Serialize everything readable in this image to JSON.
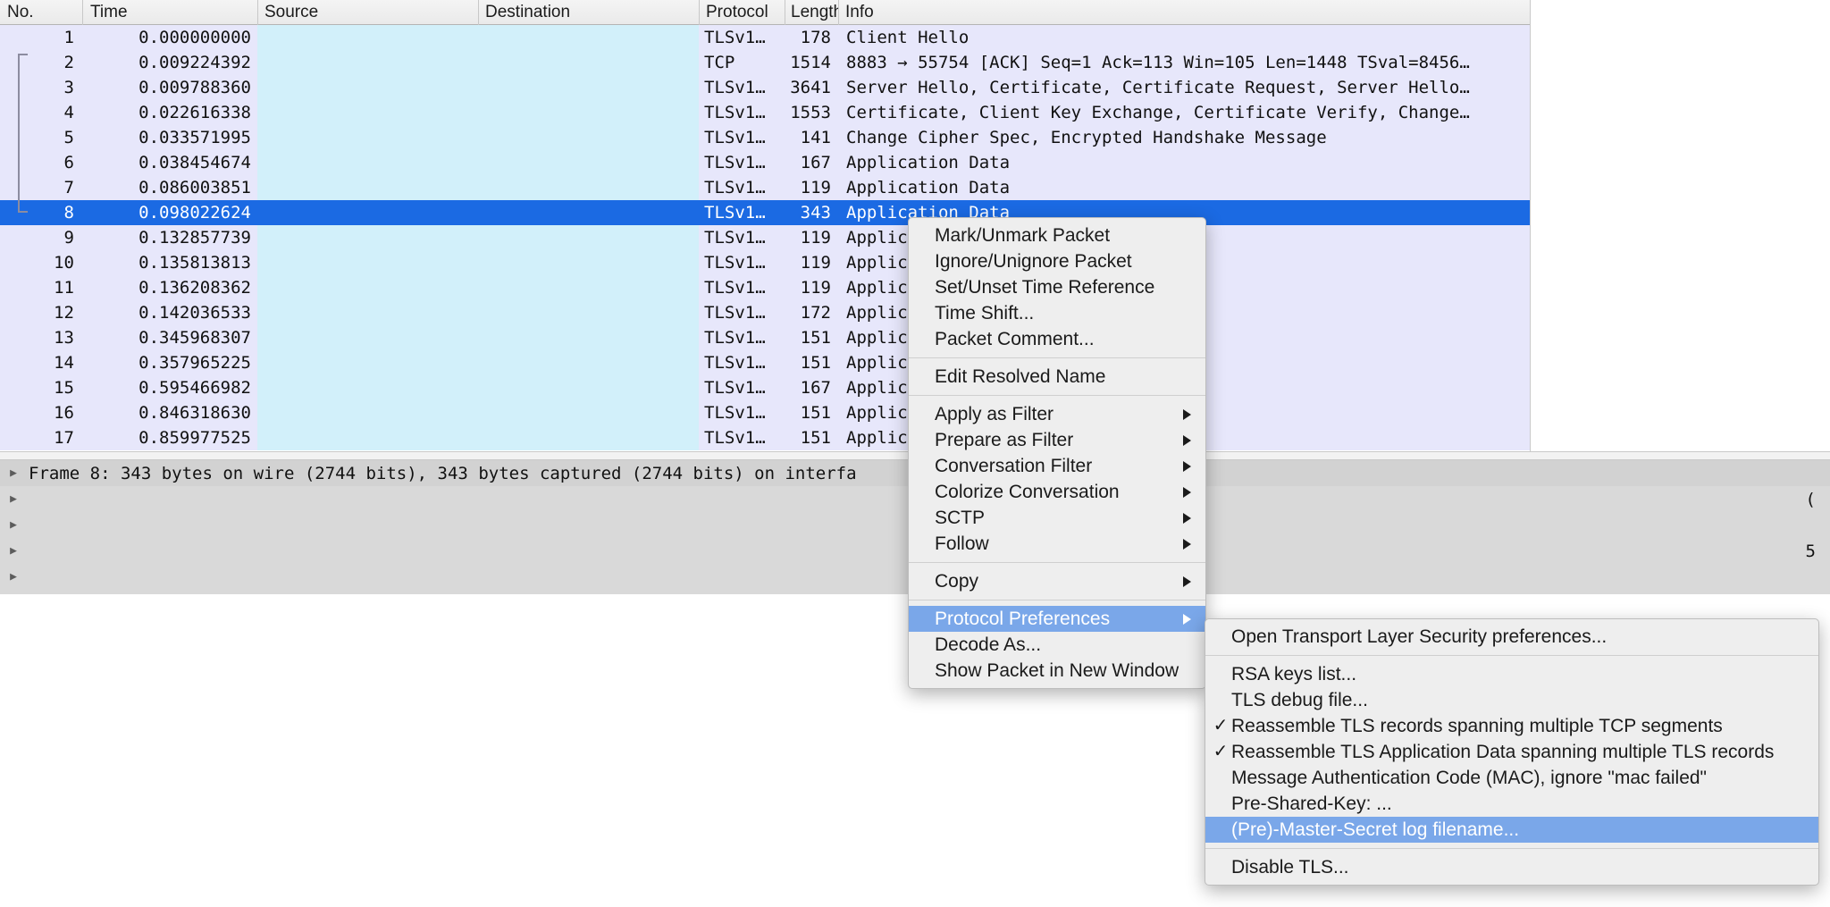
{
  "packet_list": {
    "columns": [
      "No.",
      "Time",
      "Source",
      "Destination",
      "Protocol",
      "Length",
      "Info"
    ],
    "selected_no": 8,
    "rows": [
      {
        "no": "1",
        "time": "0.000000000",
        "src": "",
        "dst": "",
        "proto": "TLSv1…",
        "len": "178",
        "info": "Client Hello"
      },
      {
        "no": "2",
        "time": "0.009224392",
        "src": "",
        "dst": "",
        "proto": "TCP",
        "len": "1514",
        "info": "8883 → 55754 [ACK] Seq=1 Ack=113 Win=105 Len=1448 TSval=8456…"
      },
      {
        "no": "3",
        "time": "0.009788360",
        "src": "",
        "dst": "",
        "proto": "TLSv1…",
        "len": "3641",
        "info": "Server Hello, Certificate, Certificate Request, Server Hello…"
      },
      {
        "no": "4",
        "time": "0.022616338",
        "src": "",
        "dst": "",
        "proto": "TLSv1…",
        "len": "1553",
        "info": "Certificate, Client Key Exchange, Certificate Verify, Change…"
      },
      {
        "no": "5",
        "time": "0.033571995",
        "src": "",
        "dst": "",
        "proto": "TLSv1…",
        "len": "141",
        "info": "Change Cipher Spec, Encrypted Handshake Message"
      },
      {
        "no": "6",
        "time": "0.038454674",
        "src": "",
        "dst": "",
        "proto": "TLSv1…",
        "len": "167",
        "info": "Application Data"
      },
      {
        "no": "7",
        "time": "0.086003851",
        "src": "",
        "dst": "",
        "proto": "TLSv1…",
        "len": "119",
        "info": "Application Data"
      },
      {
        "no": "8",
        "time": "0.098022624",
        "src": "",
        "dst": "",
        "proto": "TLSv1…",
        "len": "343",
        "info": "Application Data"
      },
      {
        "no": "9",
        "time": "0.132857739",
        "src": "",
        "dst": "",
        "proto": "TLSv1…",
        "len": "119",
        "info": "Application Data"
      },
      {
        "no": "10",
        "time": "0.135813813",
        "src": "",
        "dst": "",
        "proto": "TLSv1…",
        "len": "119",
        "info": "Application Data"
      },
      {
        "no": "11",
        "time": "0.136208362",
        "src": "",
        "dst": "",
        "proto": "TLSv1…",
        "len": "119",
        "info": "Application Data"
      },
      {
        "no": "12",
        "time": "0.142036533",
        "src": "",
        "dst": "",
        "proto": "TLSv1…",
        "len": "172",
        "info": "Application Data"
      },
      {
        "no": "13",
        "time": "0.345968307",
        "src": "",
        "dst": "",
        "proto": "TLSv1…",
        "len": "151",
        "info": "Application Data"
      },
      {
        "no": "14",
        "time": "0.357965225",
        "src": "",
        "dst": "",
        "proto": "TLSv1…",
        "len": "151",
        "info": "Application Data"
      },
      {
        "no": "15",
        "time": "0.595466982",
        "src": "",
        "dst": "",
        "proto": "TLSv1…",
        "len": "167",
        "info": "Application Data"
      },
      {
        "no": "16",
        "time": "0.846318630",
        "src": "",
        "dst": "",
        "proto": "TLSv1…",
        "len": "151",
        "info": "Application Data"
      },
      {
        "no": "17",
        "time": "0.859977525",
        "src": "",
        "dst": "",
        "proto": "TLSv1…",
        "len": "151",
        "info": "Application Data"
      }
    ]
  },
  "detail_pane": {
    "rows": [
      {
        "text": "Frame 8: 343 bytes on wire (2744 bits), 343 bytes captured (2744 bits) on interfa",
        "tail": ""
      },
      {
        "text": "",
        "tail": "("
      },
      {
        "text": "",
        "tail": ""
      },
      {
        "text": "",
        "tail": "5"
      },
      {
        "text": "",
        "tail": ""
      }
    ],
    "expander_glyph": "▶"
  },
  "context_menu": {
    "groups": [
      [
        {
          "label": "Mark/Unmark Packet",
          "submenu": false,
          "highlight": false
        },
        {
          "label": "Ignore/Unignore Packet",
          "submenu": false,
          "highlight": false
        },
        {
          "label": "Set/Unset Time Reference",
          "submenu": false,
          "highlight": false
        },
        {
          "label": "Time Shift...",
          "submenu": false,
          "highlight": false
        },
        {
          "label": "Packet Comment...",
          "submenu": false,
          "highlight": false
        }
      ],
      [
        {
          "label": "Edit Resolved Name",
          "submenu": false,
          "highlight": false
        }
      ],
      [
        {
          "label": "Apply as Filter",
          "submenu": true,
          "highlight": false
        },
        {
          "label": "Prepare as Filter",
          "submenu": true,
          "highlight": false
        },
        {
          "label": "Conversation Filter",
          "submenu": true,
          "highlight": false
        },
        {
          "label": "Colorize Conversation",
          "submenu": true,
          "highlight": false
        },
        {
          "label": "SCTP",
          "submenu": true,
          "highlight": false
        },
        {
          "label": "Follow",
          "submenu": true,
          "highlight": false
        }
      ],
      [
        {
          "label": "Copy",
          "submenu": true,
          "highlight": false
        }
      ],
      [
        {
          "label": "Protocol Preferences",
          "submenu": true,
          "highlight": true
        },
        {
          "label": "Decode As...",
          "submenu": false,
          "highlight": false
        },
        {
          "label": "Show Packet in New Window",
          "submenu": false,
          "highlight": false
        }
      ]
    ]
  },
  "submenu": {
    "groups": [
      [
        {
          "label": "Open Transport Layer Security preferences...",
          "check": "",
          "highlight": false
        }
      ],
      [
        {
          "label": "RSA keys list...",
          "check": "",
          "highlight": false
        },
        {
          "label": "TLS debug file...",
          "check": "",
          "highlight": false
        },
        {
          "label": "Reassemble TLS records spanning multiple TCP segments",
          "check": "✓",
          "highlight": false
        },
        {
          "label": "Reassemble TLS Application Data spanning multiple TLS records",
          "check": "✓",
          "highlight": false
        },
        {
          "label": "Message Authentication Code (MAC), ignore \"mac failed\"",
          "check": "",
          "highlight": false
        },
        {
          "label": "Pre-Shared-Key: ...",
          "check": "",
          "highlight": false
        },
        {
          "label": "(Pre)-Master-Secret log filename...",
          "check": "",
          "highlight": true
        }
      ],
      [
        {
          "label": "Disable TLS...",
          "check": "",
          "highlight": false
        }
      ]
    ]
  },
  "colors": {
    "selection_blue": "#1b6ae3",
    "menu_highlight": "#7aa7e9",
    "row_background": "#e7e7fb",
    "addr_column_background": "#d2f0fa",
    "detail_background": "#d9d9d9"
  }
}
